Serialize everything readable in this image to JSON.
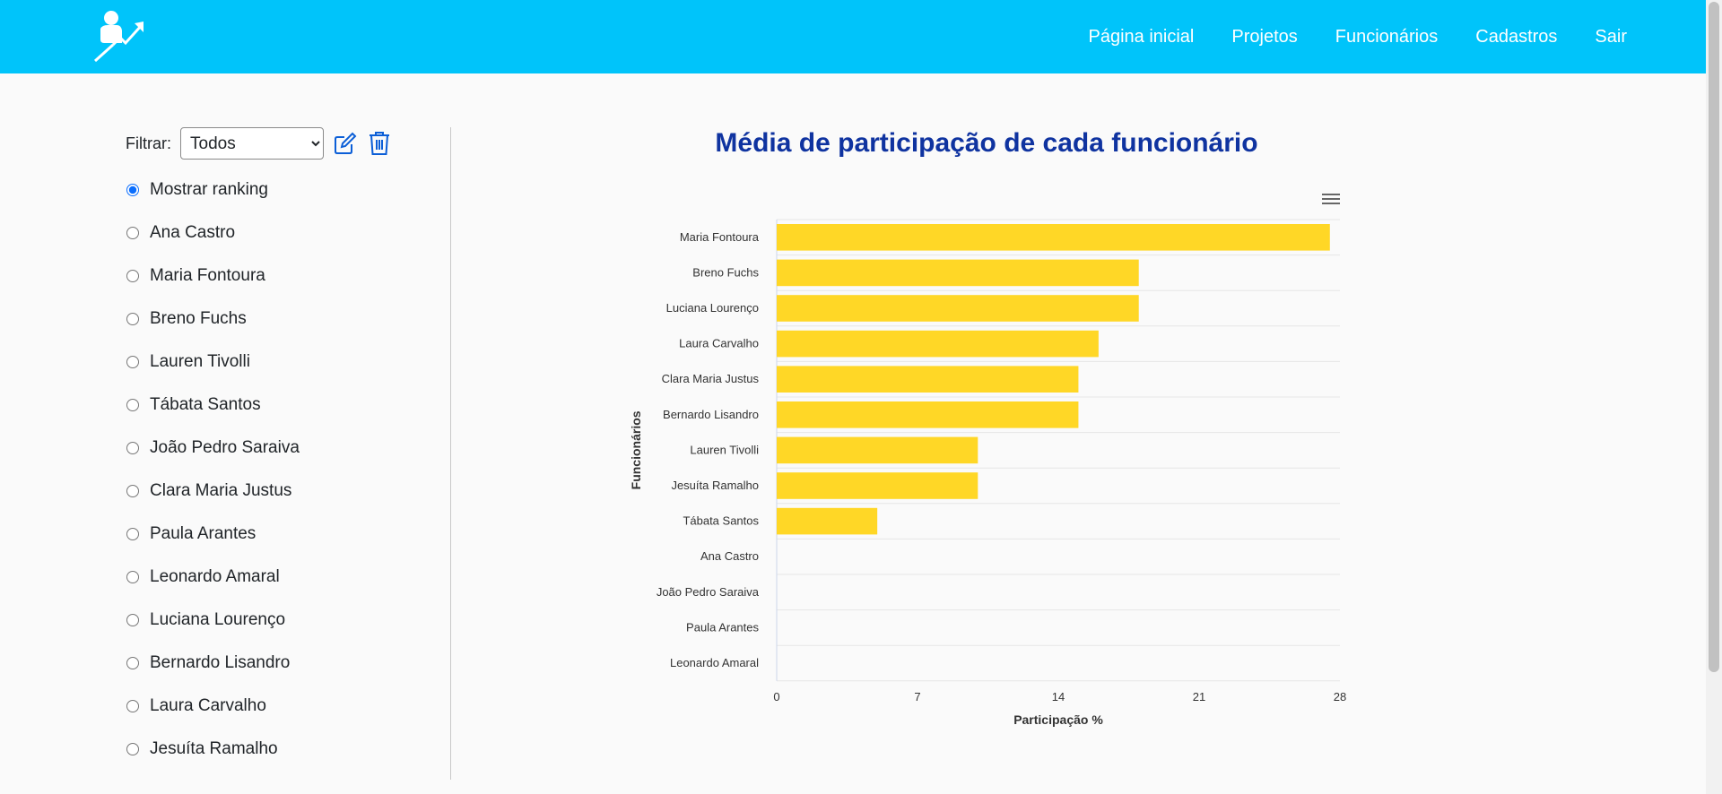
{
  "nav": {
    "logo": "logo-icon",
    "links": [
      "Página inicial",
      "Projetos",
      "Funcionários",
      "Cadastros",
      "Sair"
    ]
  },
  "sidebar": {
    "filter_label": "Filtrar:",
    "filter_value": "Todos",
    "edit_icon": "edit-icon",
    "delete_icon": "trash-icon",
    "options": [
      "Mostrar ranking",
      "Ana Castro",
      "Maria Fontoura",
      "Breno Fuchs",
      "Lauren Tivolli",
      "Tábata Santos",
      "João Pedro Saraiva",
      "Clara Maria Justus",
      "Paula Arantes",
      "Leonardo Amaral",
      "Luciana Lourenço",
      "Bernardo Lisandro",
      "Laura Carvalho",
      "Jesuíta Ramalho"
    ],
    "selected": "Mostrar ranking"
  },
  "chart": {
    "menu_icon": "hamburger-menu-icon"
  },
  "colors": {
    "navbar": "#00c4fa",
    "title": "#0f33a0",
    "bar": "#ffd726"
  },
  "chart_data": {
    "type": "bar",
    "orientation": "horizontal",
    "title": "Média de participação de cada funcionário",
    "xlabel": "Participação %",
    "ylabel": "Funcionários",
    "categories": [
      "Maria Fontoura",
      "Breno Fuchs",
      "Luciana Lourenço",
      "Laura Carvalho",
      "Clara Maria Justus",
      "Bernardo Lisandro",
      "Lauren Tivolli",
      "Jesuíta Ramalho",
      "Tábata Santos",
      "Ana Castro",
      "João Pedro Saraiva",
      "Paula Arantes",
      "Leonardo Amaral"
    ],
    "values": [
      27.5,
      18,
      18,
      16,
      15,
      15,
      10,
      10,
      5,
      0,
      0,
      0,
      0
    ],
    "xlim": [
      0,
      28
    ],
    "xticks": [
      "0",
      "7",
      "14",
      "21",
      "28"
    ],
    "grid": true
  }
}
